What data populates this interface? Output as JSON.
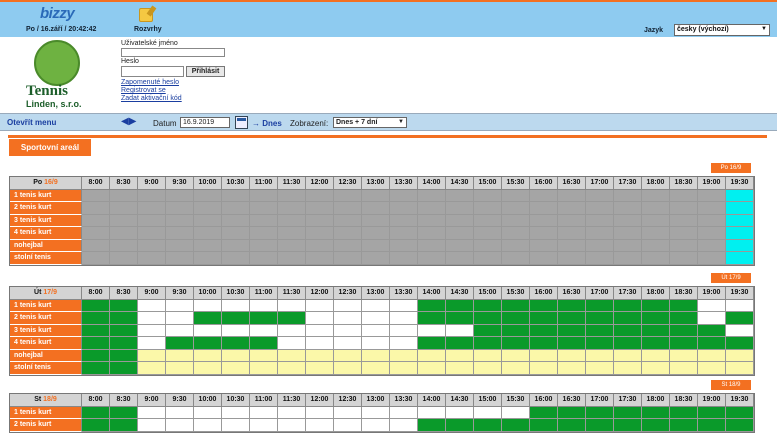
{
  "header": {
    "brand": "bizzy",
    "datetime": "Po / 16.září / 20:42:42",
    "rozvrhy_label": "Rozvrhy",
    "language_label": "Jazyk",
    "language_value": "česky (výchozí)"
  },
  "logo": {
    "title": "Tennis",
    "subtitle": "Linden, s.r.o."
  },
  "login": {
    "username_label": "Uživatelské jméno",
    "password_label": "Heslo",
    "submit_label": "Přihlásit",
    "links": [
      "Zapomenuté heslo",
      "Registrovat se",
      "Zadat aktivační kód"
    ]
  },
  "nav": {
    "menu_label": "Otevřít menu",
    "date_label": "Datum",
    "date_value": "16.9.2019",
    "today_label": "→ Dnes",
    "view_label": "Zobrazení:",
    "view_value": "Dnes + 7 dní"
  },
  "tab_label": "Sportovní areál",
  "times": [
    "8:00",
    "8:30",
    "9:00",
    "9:30",
    "10:00",
    "10:30",
    "11:00",
    "11:30",
    "12:00",
    "12:30",
    "13:00",
    "13:30",
    "14:00",
    "14:30",
    "15:00",
    "15:30",
    "16:00",
    "16:30",
    "17:00",
    "17:30",
    "18:00",
    "18:30",
    "19:00",
    "19:30"
  ],
  "colors": {
    "accent": "#f37021",
    "occupied": "#0a9a2a",
    "past": "#a5a5a5",
    "current": "#00f0f0",
    "free": "#ffffff",
    "special": "#fbf8a9"
  },
  "days": [
    {
      "badge": "Po 16/9",
      "day_name": "Po",
      "day_date": "16/9",
      "courts": [
        {
          "name": "1 tenis kurt",
          "slots": "gggggggggggggggggggggggcc"
        },
        {
          "name": "2 tenis kurt",
          "slots": "gggggggggggggggggggggggcc"
        },
        {
          "name": "3 tenis kurt",
          "slots": "gggggggggggggggggggggggcc"
        },
        {
          "name": "4 tenis kurt",
          "slots": "gggggggggggggggggggggggcc"
        },
        {
          "name": "nohejbal",
          "slots": "gggggggggggggggggggggggcc"
        },
        {
          "name": "stolní tenis",
          "slots": "gggggggggggggggggggggggcc"
        }
      ]
    },
    {
      "badge": "Út 17/9",
      "day_name": "Út",
      "day_date": "17/9",
      "courts": [
        {
          "name": "1 tenis kurt",
          "slots": "GGwwwwwwwwwwGGGGGGGGGGww"
        },
        {
          "name": "2 tenis kurt",
          "slots": "GGwwGGGGwwwwGGGGGGGGGGwG"
        },
        {
          "name": "3 tenis kurt",
          "slots": "GGwwwwwwwwwwwwGGGGGGGGGw"
        },
        {
          "name": "4 tenis kurt",
          "slots": "GGwGGGGwwwwwGGGGGGGGGGGG"
        },
        {
          "name": "nohejbal",
          "slots": "GGyyyyyyyyyyyyyyyyyyyyyy"
        },
        {
          "name": "stolní tenis",
          "slots": "GGyyyyyyyyyyyyyyyyyyyyyy"
        }
      ]
    },
    {
      "badge": "St 18/9",
      "day_name": "St",
      "day_date": "18/9",
      "courts": [
        {
          "name": "1 tenis kurt",
          "slots": "GGwwwwwwwwwwwwwwGGGGGGGG"
        },
        {
          "name": "2 tenis kurt",
          "slots": "GGwwwwwwwwwwGGGGGGGGGGGG"
        }
      ]
    }
  ]
}
